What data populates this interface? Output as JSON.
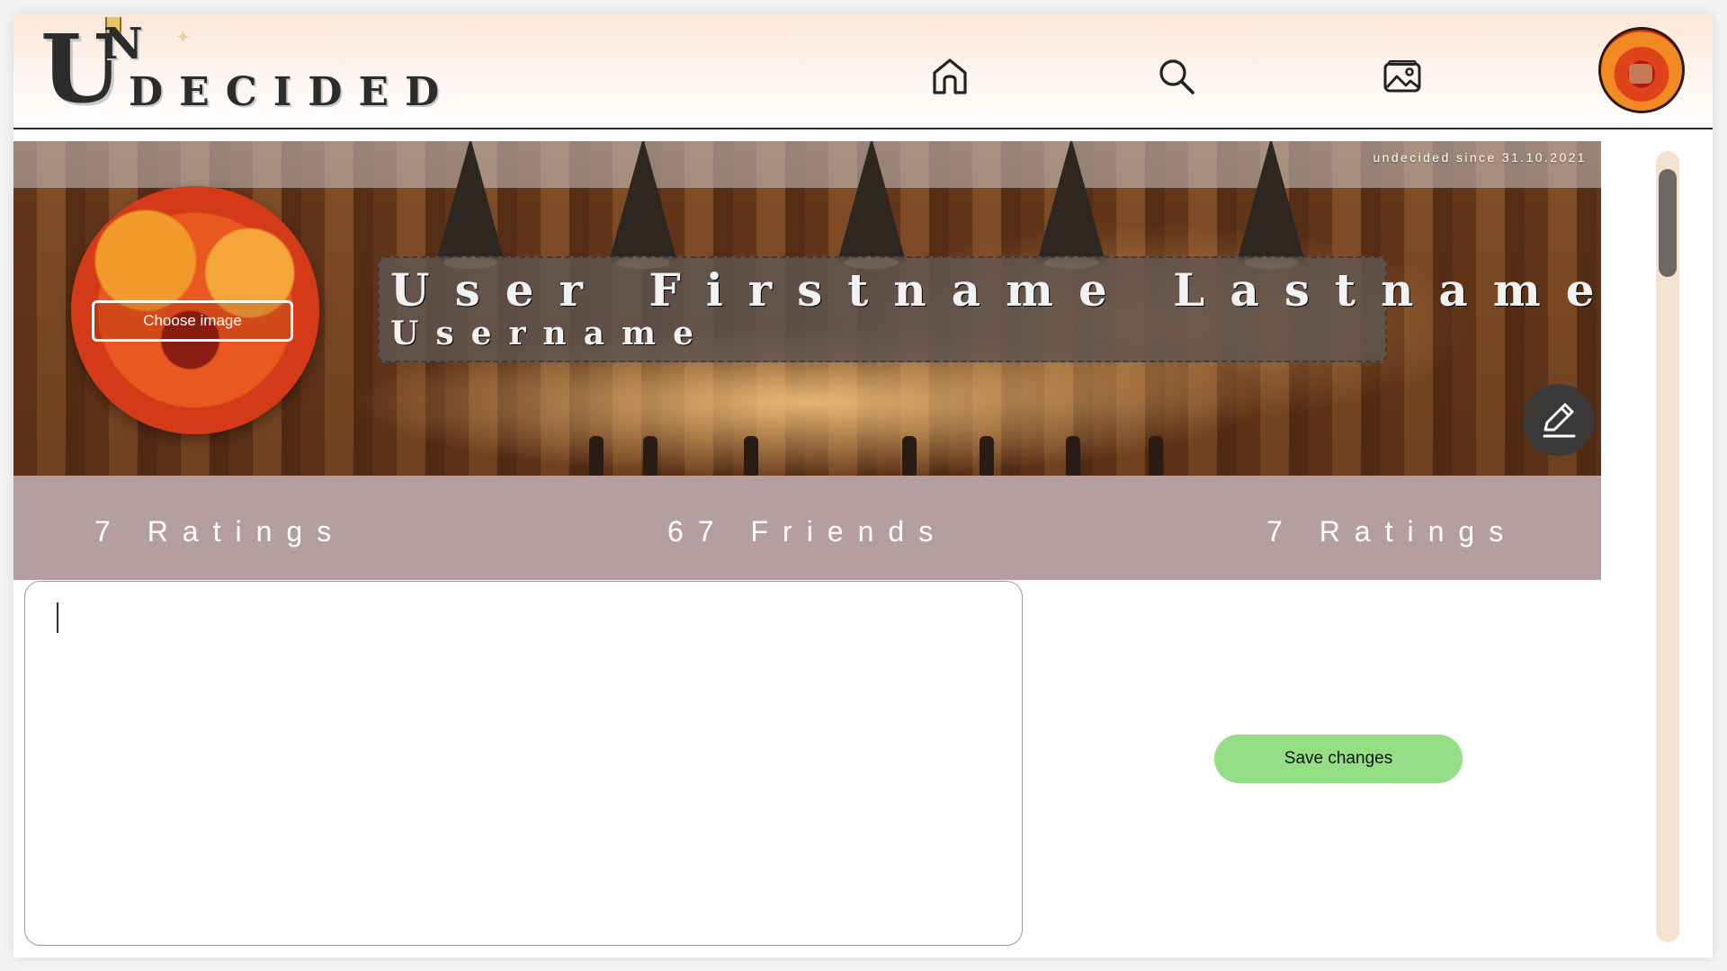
{
  "app": {
    "logo_big_letter": "U",
    "logo_small_letter": "N",
    "logo_rest": "DECIDED"
  },
  "nav": {
    "icons": [
      "home-icon",
      "search-icon",
      "gallery-icon",
      "avatar"
    ]
  },
  "profile": {
    "since": "undecided since 31.10.2021",
    "choose_image_label": "Choose image",
    "full_name": "User Firstname Lastname",
    "username": "Username"
  },
  "stats": [
    {
      "label": "7 Ratings"
    },
    {
      "label": "67 Friends"
    },
    {
      "label": "7 Ratings"
    }
  ],
  "bio": {
    "value": "",
    "placeholder": ""
  },
  "actions": {
    "save_label": "Save changes"
  },
  "colors": {
    "stats_bar": "#b59ea0",
    "save_button": "#94df86",
    "scroll_track": "#f5e3d1"
  }
}
